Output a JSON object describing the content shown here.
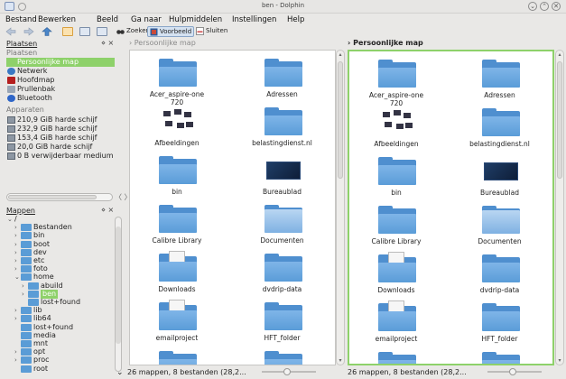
{
  "window": {
    "title": "ben - Dolphin",
    "buttons": [
      "⌄",
      "⌃",
      "✕"
    ]
  },
  "menu": [
    "Bestand",
    "Bewerken",
    "Beeld",
    "Ga naar",
    "Hulpmiddelen",
    "Instellingen",
    "Help"
  ],
  "toolbar": {
    "search_label": "Zoeken",
    "preview_label": "Voorbeeld",
    "close_label": "Sluiten"
  },
  "places_panel": {
    "title": "Plaatsen",
    "controls": "⋄ ×",
    "group_places": "Plaatsen",
    "places": [
      {
        "label": "Persoonlijke map",
        "icon": "home-folder-icon",
        "color": "#8ed16a"
      },
      {
        "label": "Netwerk",
        "icon": "network-icon",
        "color": "#3a78c3"
      },
      {
        "label": "Hoofdmap",
        "icon": "root-folder-icon",
        "color": "#b51f1f"
      },
      {
        "label": "Prullenbak",
        "icon": "trash-icon",
        "color": "#9aa6b5"
      },
      {
        "label": "Bluetooth",
        "icon": "bluetooth-icon",
        "color": "#2f66c8"
      }
    ],
    "group_devices": "Apparaten",
    "devices": [
      {
        "label": "210,9 GiB harde schijf",
        "icon": "harddisk-icon"
      },
      {
        "label": "232,9 GiB harde schijf",
        "icon": "harddisk-icon"
      },
      {
        "label": "153,4 GiB harde schijf",
        "icon": "harddisk-icon"
      },
      {
        "label": "20,0 GiB harde schijf",
        "icon": "harddisk-icon"
      },
      {
        "label": "0 B verwijderbaar medium",
        "icon": "removable-media-icon"
      }
    ],
    "scroll_arrows": "〈 〉"
  },
  "folders_panel": {
    "title": "Mappen",
    "controls": "⋄ ×",
    "tree": [
      {
        "label": "/",
        "expander": "⌄",
        "depth": 0
      },
      {
        "label": "Bestanden",
        "expander": "›",
        "depth": 1
      },
      {
        "label": "bin",
        "expander": "›",
        "depth": 1
      },
      {
        "label": "boot",
        "expander": "›",
        "depth": 1
      },
      {
        "label": "dev",
        "expander": "›",
        "depth": 1
      },
      {
        "label": "etc",
        "expander": "›",
        "depth": 1
      },
      {
        "label": "foto",
        "expander": "›",
        "depth": 1
      },
      {
        "label": "home",
        "expander": "⌄",
        "depth": 1
      },
      {
        "label": "abuild",
        "expander": "›",
        "depth": 2
      },
      {
        "label": "ben",
        "expander": "›",
        "depth": 2,
        "selected": true
      },
      {
        "label": "lost+found",
        "expander": "",
        "depth": 2
      },
      {
        "label": "lib",
        "expander": "›",
        "depth": 1
      },
      {
        "label": "lib64",
        "expander": "›",
        "depth": 1
      },
      {
        "label": "lost+found",
        "expander": "",
        "depth": 1
      },
      {
        "label": "media",
        "expander": "",
        "depth": 1
      },
      {
        "label": "mnt",
        "expander": "",
        "depth": 1
      },
      {
        "label": "opt",
        "expander": "›",
        "depth": 1
      },
      {
        "label": "proc",
        "expander": "›",
        "depth": 1
      },
      {
        "label": "root",
        "expander": "",
        "depth": 1
      }
    ]
  },
  "views": [
    {
      "breadcrumb": "› Persoonlijke map",
      "status": "26 mappen, 8 bestanden (28,2...",
      "expand_marker": "⌄"
    },
    {
      "breadcrumb": "› Persoonlijke map",
      "status": "26 mappen, 8 bestanden (28,2...",
      "expand_marker": ""
    }
  ],
  "items": [
    {
      "label": "Acer_aspire-one\n720",
      "kind": "plain"
    },
    {
      "label": "Adressen",
      "kind": "plain"
    },
    {
      "label": "Afbeeldingen",
      "kind": "photos"
    },
    {
      "label": "belastingdienst.nl",
      "kind": "plain"
    },
    {
      "label": "bin",
      "kind": "plain"
    },
    {
      "label": "Bureaublad",
      "kind": "desktop"
    },
    {
      "label": "Calibre Library",
      "kind": "plain"
    },
    {
      "label": "Documenten",
      "kind": "documents"
    },
    {
      "label": "Downloads",
      "kind": "paper"
    },
    {
      "label": "dvdrip-data",
      "kind": "plain"
    },
    {
      "label": "emailproject",
      "kind": "paper"
    },
    {
      "label": "HFT_folder",
      "kind": "plain"
    },
    {
      "label": "",
      "kind": "plain"
    },
    {
      "label": "",
      "kind": "plain"
    }
  ],
  "colors": {
    "selection": "#8ed16a",
    "folder": "#5a9cd6",
    "active_view_border": "#8ed16a"
  }
}
